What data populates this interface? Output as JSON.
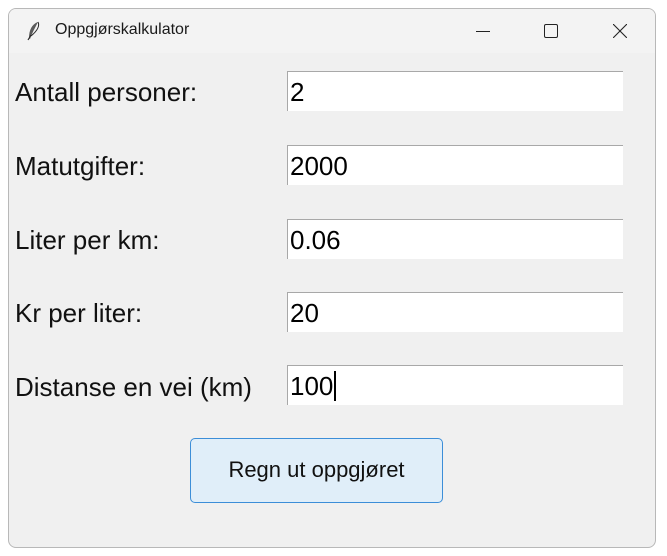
{
  "window": {
    "title": "Oppgjørskalkulator",
    "app_icon": "feather-icon",
    "controls": [
      "minimize-icon",
      "maximize-icon",
      "close-icon"
    ]
  },
  "form": {
    "fields": [
      {
        "label": "Antall personer:",
        "value": "2"
      },
      {
        "label": "Matutgifter:",
        "value": "2000"
      },
      {
        "label": "Liter per km:",
        "value": "0.06"
      },
      {
        "label": "Kr per liter:",
        "value": "20"
      },
      {
        "label": "Distanse en vei (km)",
        "value": "100"
      }
    ],
    "submit_label": "Regn ut oppgjøret"
  },
  "colors": {
    "window_bg": "#f0f0f0",
    "button_bg": "#e0eef9",
    "button_border": "#3c8ed8"
  }
}
